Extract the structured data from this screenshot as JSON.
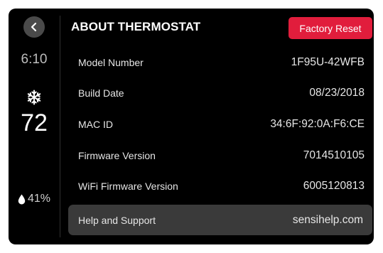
{
  "status": {
    "time": "6:10",
    "mode_icon": "snowflake-icon",
    "temperature": "72",
    "humidity": "41%"
  },
  "header": {
    "title": "ABOUT THERMOSTAT",
    "reset_label": "Factory Reset",
    "reset_color": "#e11d3c"
  },
  "info": {
    "rows": [
      {
        "label": "Model Number",
        "value": "1F95U-42WFB"
      },
      {
        "label": "Build Date",
        "value": "08/23/2018"
      },
      {
        "label": "MAC ID",
        "value": "34:6F:92:0A:F6:CE"
      },
      {
        "label": "Firmware Version",
        "value": "7014510105"
      },
      {
        "label": "WiFi Firmware Version",
        "value": "6005120813"
      }
    ]
  },
  "support": {
    "label": "Help and Support",
    "value": "sensihelp.com"
  }
}
